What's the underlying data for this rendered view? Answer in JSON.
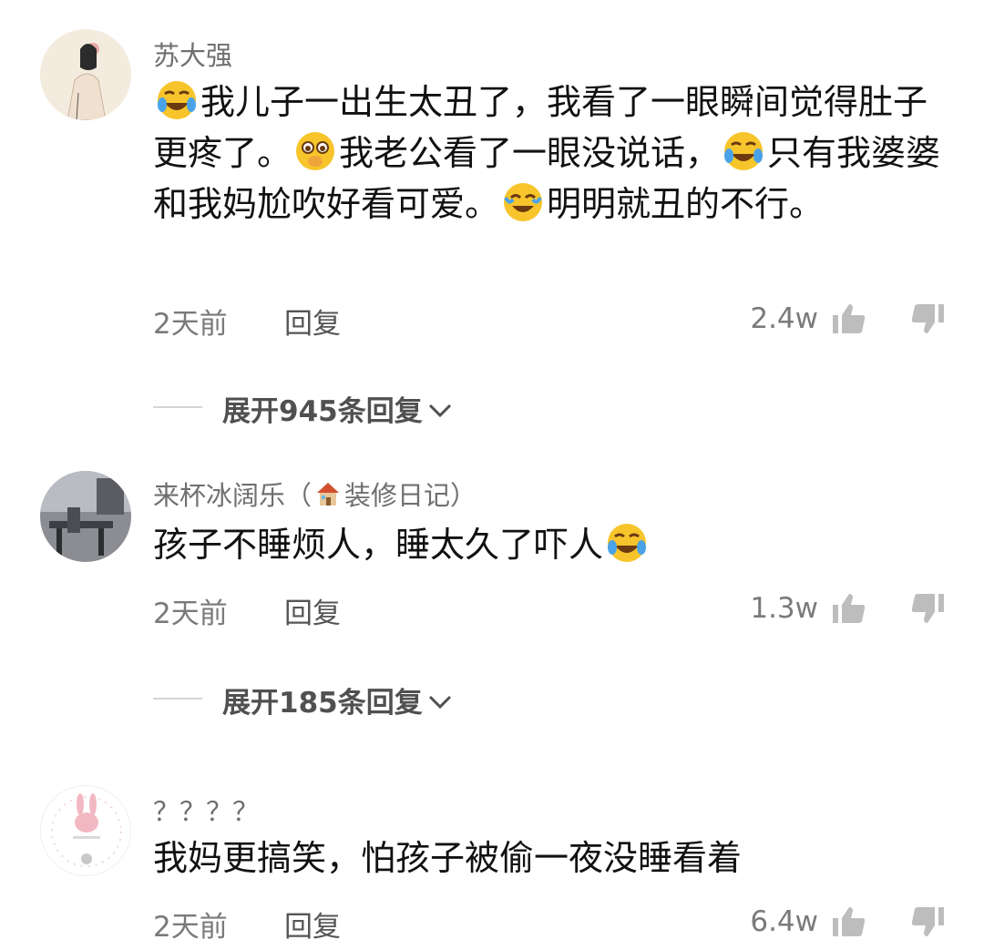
{
  "comments": [
    {
      "username": "苏大强",
      "text_segments": [
        "我儿子一出生太丑了，我看了一眼瞬间觉得肚子更疼了。",
        "我老公看了一眼没说话，",
        "只有我婆婆和我妈尬吹好看可爱。",
        "明明就丑的不行。"
      ],
      "time": "2天前",
      "reply": "回复",
      "likes": "2.4w",
      "expand": "展开945条回复",
      "avatar_icon": "woman-avatar"
    },
    {
      "username_prefix": "来杯冰阔乐（",
      "username_suffix": "装修日记）",
      "username_icon": "house-icon",
      "text": "孩子不睡烦人，睡太久了吓人",
      "time": "2天前",
      "reply": "回复",
      "likes": "1.3w",
      "expand": "展开185条回复",
      "avatar_icon": "room-avatar"
    },
    {
      "username": "？？？？",
      "text": "我妈更搞笑，怕孩子被偷一夜没睡看着",
      "time": "2天前",
      "reply": "回复",
      "likes": "6.4w",
      "avatar_icon": "bunny-avatar"
    }
  ],
  "colors": {
    "username": "#6f6f6f",
    "text": "#111111",
    "meta": "#7a7a7a",
    "emoji_face": "#f7c52b"
  }
}
